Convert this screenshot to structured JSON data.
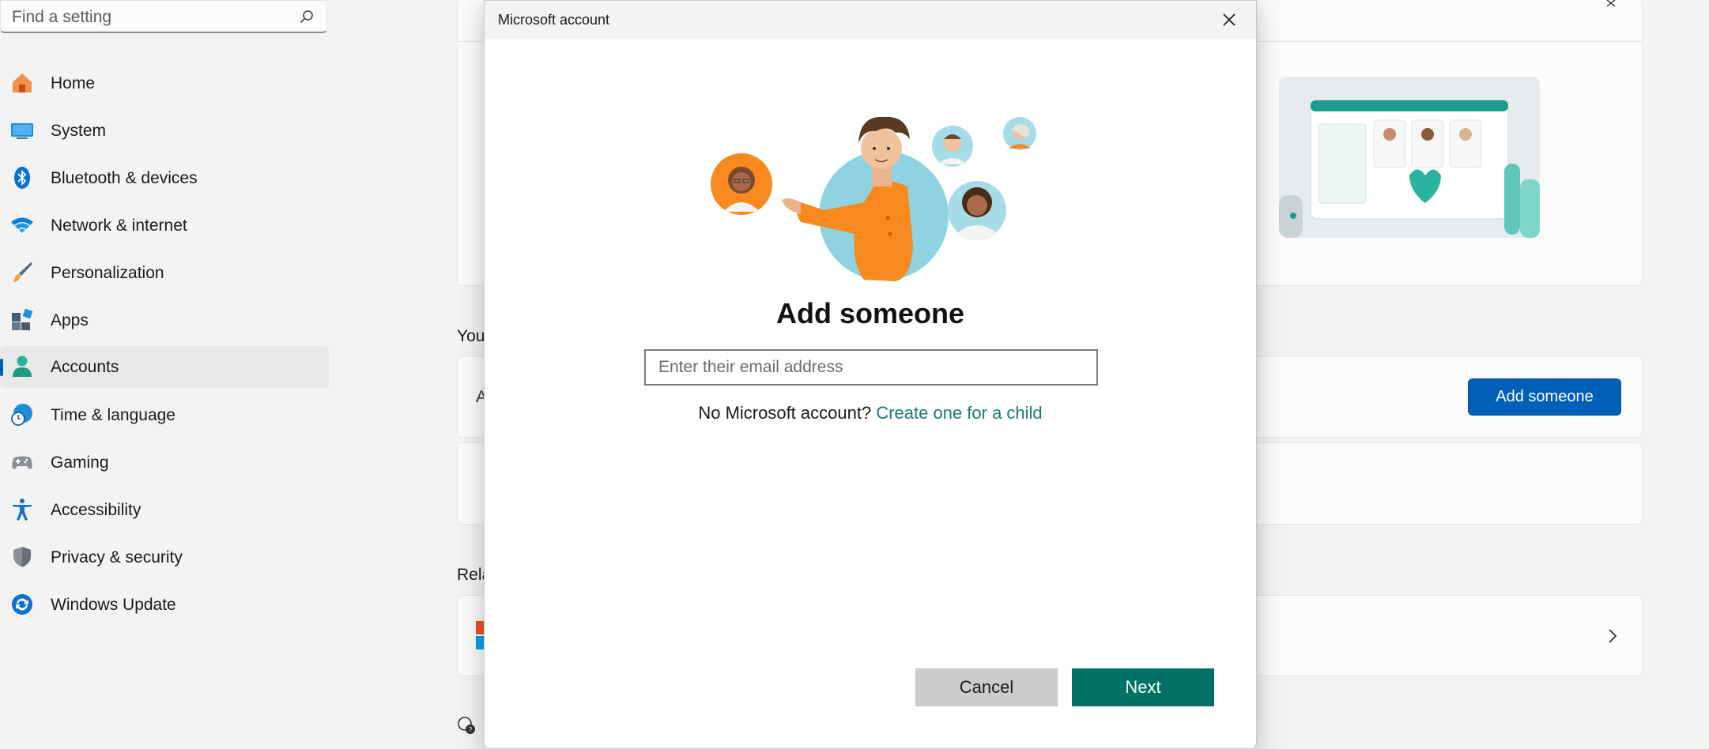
{
  "search": {
    "placeholder": "Find a setting"
  },
  "sidebar": {
    "items": [
      {
        "label": "Home",
        "icon": "home-icon",
        "color": "#e8632b"
      },
      {
        "label": "System",
        "icon": "monitor-icon",
        "color": "#0078d4"
      },
      {
        "label": "Bluetooth & devices",
        "icon": "bluetooth-icon",
        "color": "#0078d4"
      },
      {
        "label": "Network & internet",
        "icon": "wifi-icon",
        "color": "#0a84d6"
      },
      {
        "label": "Personalization",
        "icon": "brush-icon",
        "color": "#c88a3a"
      },
      {
        "label": "Apps",
        "icon": "apps-icon",
        "color": "#4a5a70"
      },
      {
        "label": "Accounts",
        "icon": "person-icon",
        "color": "#2bb39a"
      },
      {
        "label": "Time & language",
        "icon": "clock-globe-icon",
        "color": "#1a8fd6"
      },
      {
        "label": "Gaming",
        "icon": "gamepad-icon",
        "color": "#7a7a7a"
      },
      {
        "label": "Accessibility",
        "icon": "accessibility-icon",
        "color": "#1a6fc9"
      },
      {
        "label": "Privacy & security",
        "icon": "shield-icon",
        "color": "#6e7680"
      },
      {
        "label": "Windows Update",
        "icon": "update-icon",
        "color": "#0a6fd6"
      }
    ],
    "active_index": 6
  },
  "background": {
    "section_your": "You",
    "section_related": "Rela",
    "row_letter": "A",
    "add_someone_label": "Add someone"
  },
  "dialog": {
    "title": "Microsoft account",
    "heading": "Add someone",
    "email_placeholder": "Enter their email address",
    "no_account_text": "No Microsoft account?",
    "create_link": "Create one for a child",
    "cancel_label": "Cancel",
    "next_label": "Next"
  },
  "colors": {
    "accent": "#005fb8",
    "next_button": "#007265",
    "link": "#1a7b6e",
    "person_shirt": "#f7891f",
    "circle_blue": "#8fd3e3"
  }
}
